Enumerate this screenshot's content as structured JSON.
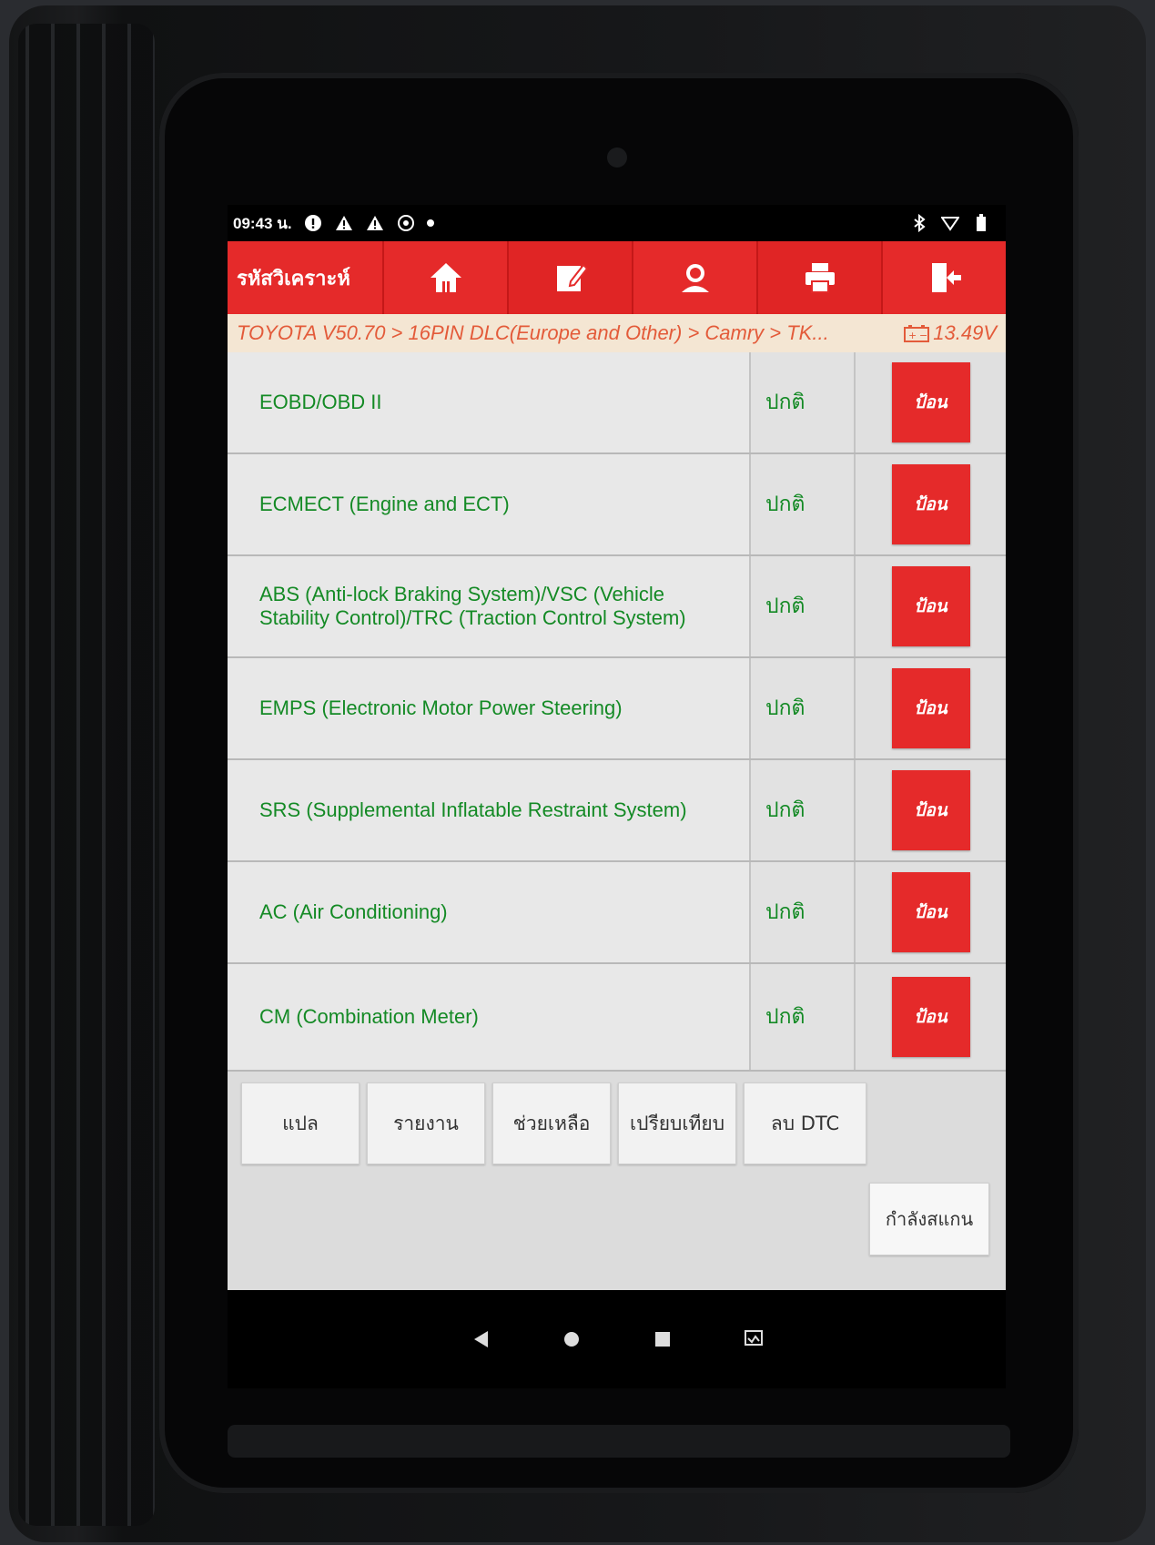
{
  "status_bar": {
    "time": "09:43 น.",
    "left_icons": [
      "info-icon",
      "warning-icon",
      "warning-icon",
      "vehicle-icon"
    ],
    "right_icons": [
      "bluetooth-icon",
      "wifi-icon",
      "battery-icon"
    ]
  },
  "toolbar": {
    "title": "รหัสวิเคราะห์",
    "buttons": [
      "home-icon",
      "edit-icon",
      "support-icon",
      "print-icon",
      "exit-icon"
    ]
  },
  "breadcrumb": {
    "path": "TOYOTA V50.70 > 16PIN DLC(Europe and Other) > Camry > TK...",
    "voltage": "13.49V"
  },
  "systems": [
    {
      "name": "EOBD/OBD II",
      "status": "ปกติ",
      "action": "ป้อน"
    },
    {
      "name": "ECMECT (Engine and ECT)",
      "status": "ปกติ",
      "action": "ป้อน"
    },
    {
      "name": "ABS (Anti-lock Braking System)/VSC (Vehicle Stability Control)/TRC (Traction Control System)",
      "status": "ปกติ",
      "action": "ป้อน"
    },
    {
      "name": "EMPS (Electronic Motor Power Steering)",
      "status": "ปกติ",
      "action": "ป้อน"
    },
    {
      "name": "SRS (Supplemental Inflatable Restraint System)",
      "status": "ปกติ",
      "action": "ป้อน"
    },
    {
      "name": "AC (Air Conditioning)",
      "status": "ปกติ",
      "action": "ป้อน"
    },
    {
      "name": "CM (Combination Meter)",
      "status": "ปกติ",
      "action": "ป้อน"
    }
  ],
  "bottom_buttons": [
    "แปล",
    "รายงาน",
    "ช่วยเหลือ",
    "เปรียบเทียบ",
    "ลบ DTC"
  ],
  "scan_button": "กำลังสแกน",
  "nav_bar": [
    "back-icon",
    "home-icon",
    "recents-icon",
    "screenshot-icon"
  ],
  "colors": {
    "accent": "#e52a2a",
    "system_text": "#148a25",
    "breadcrumb_text": "#e35b3a",
    "breadcrumb_bg": "#f4e6d3"
  }
}
